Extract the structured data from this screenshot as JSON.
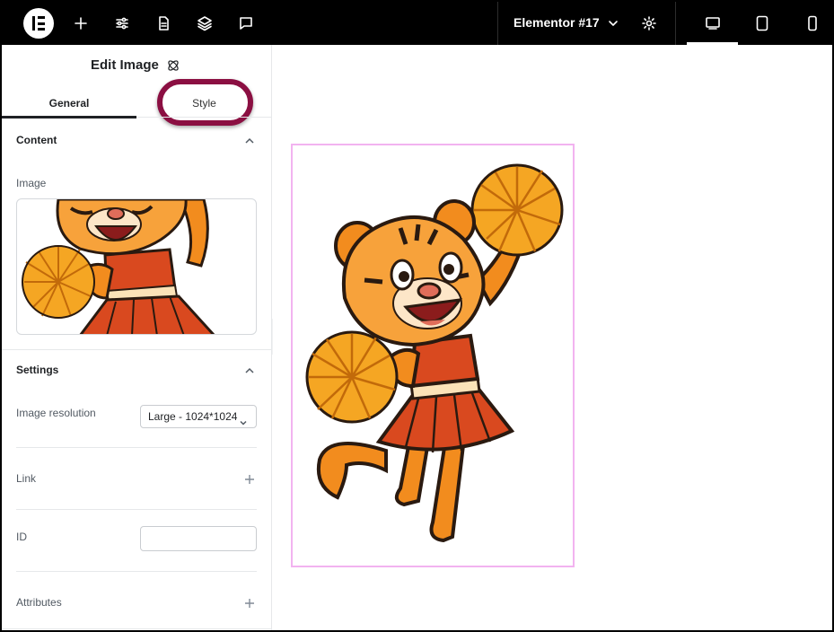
{
  "topbar": {
    "page_title": "Elementor #17",
    "icons": [
      "elementor-logo",
      "add-icon",
      "settings-sliders-icon",
      "page-icon",
      "layers-icon",
      "comment-icon",
      "chevron-down-icon",
      "gear-icon",
      "desktop-icon",
      "tablet-icon",
      "mobile-icon"
    ]
  },
  "panel": {
    "title": "Edit Image",
    "tabs": [
      "General",
      "Style"
    ],
    "content_section": {
      "title": "Content",
      "image_label": "Image"
    },
    "settings_section": {
      "title": "Settings",
      "resolution_label": "Image resolution",
      "resolution_value": "Large - 1024*1024",
      "link_label": "Link",
      "id_label": "ID",
      "id_value": "",
      "attributes_label": "Attributes"
    }
  },
  "colors": {
    "topbar": "#000000",
    "highlight": "#8b0f42",
    "widget_outline": "#f2b3f0"
  }
}
